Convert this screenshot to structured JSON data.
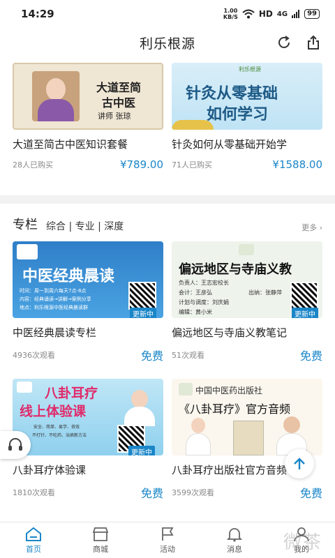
{
  "status": {
    "time": "14:29",
    "speed_value": "1.00",
    "speed_unit": "KB/S",
    "hd": "HD",
    "signal": "4G",
    "battery": "99"
  },
  "header": {
    "title": "利乐根源"
  },
  "courses": [
    {
      "cover_title_1": "大道至简",
      "cover_title_2": "古中医",
      "cover_teacher": "讲师  张琼",
      "title": "大道至简古中医知识套餐",
      "buyers": "28人已购买",
      "price": "¥789.00"
    },
    {
      "cover_logo": "利乐根源",
      "cover_title_1": "针灸从零基础",
      "cover_title_2": "如何学习",
      "title": "针灸如何从零基础开始学",
      "buyers": "71人已购买",
      "price": "¥1588.00"
    }
  ],
  "column": {
    "title": "专栏",
    "tabs": "综合 | 专业 | 深度",
    "more": "更多",
    "items": [
      {
        "cover_title": "中医经典晨读",
        "cover_line_1": "时间：周一到周六每天7点-8点",
        "cover_line_2": "内容：经典诵读→讲解→案例分享",
        "cover_line_3": "地点：利乐根源中医经典晨读群",
        "update": "更新中",
        "title": "中医经典晨读专栏",
        "views": "4936次观看",
        "price": "免费"
      },
      {
        "cover_title": "偏远地区与寺庙义教",
        "cover_line_1": "负责人：王志宏校长",
        "cover_line_2": "会计：王彦弘",
        "cover_line_3": "出纳：张静萍",
        "cover_line_4": "计划与调度：刘庆娟",
        "cover_line_5": "编辑：黄小米",
        "update": "更新中",
        "title": "偏远地区与寺庙义教笔记",
        "views": "51次观看",
        "price": "免费"
      },
      {
        "cover_title_1": "八卦耳疗",
        "cover_title_2": "线上体验课",
        "cover_line_1": "安全、简单、易学、奇效",
        "cover_line_2": "不打针、不吃药、治病新方法",
        "update": "更新中",
        "title": "八卦耳疗体验课",
        "views": "1810次观看",
        "price": "免费"
      },
      {
        "cover_publisher": "中国中医药出版社",
        "cover_title": "《八卦耳疗》官方音频",
        "title": "八卦耳疗出版社官方音频",
        "views": "3599次观看",
        "price": "免费"
      }
    ]
  },
  "tabs": [
    {
      "label": "首页"
    },
    {
      "label": "商城"
    },
    {
      "label": "活动"
    },
    {
      "label": "消息"
    },
    {
      "label": "我的"
    }
  ],
  "watermark": "微茶",
  "colors": {
    "accent": "#1a86c8"
  }
}
